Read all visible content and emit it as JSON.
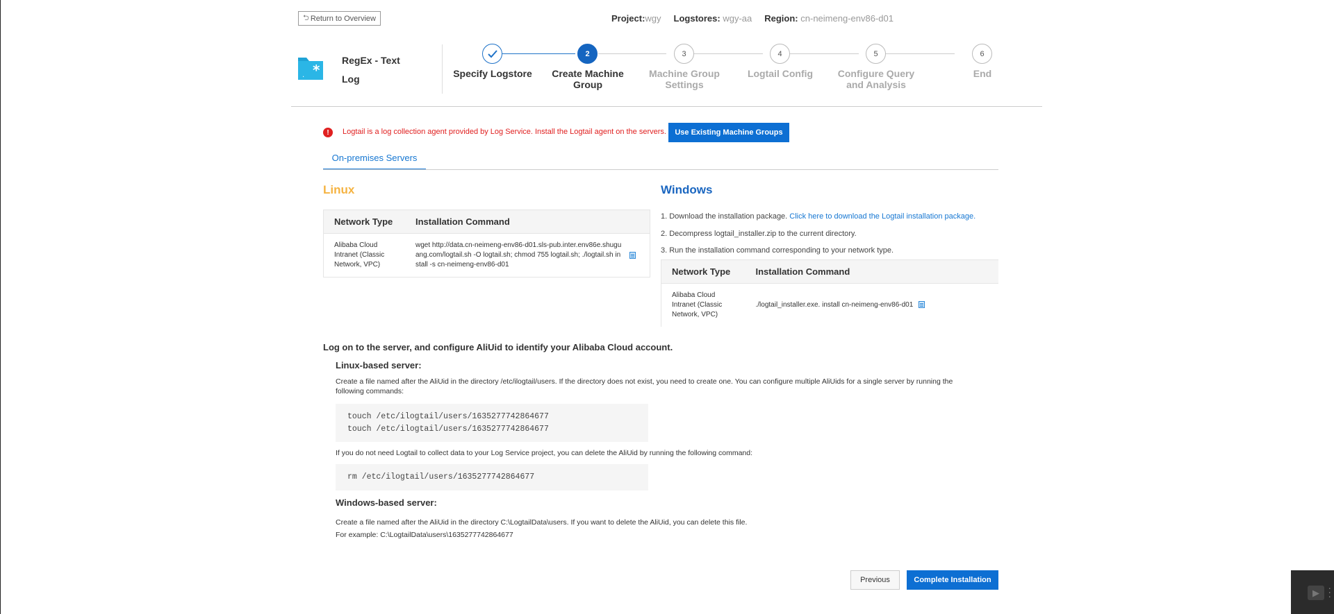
{
  "header": {
    "return_label": "Return to Overview",
    "project_label": "Project:",
    "project_value": "wgy",
    "logstores_label": "Logstores:",
    "logstores_value": "wgy-aa",
    "region_label": "Region:",
    "region_value": "cn-neimeng-env86-d01"
  },
  "log_type": {
    "title": "RegEx - Text Log",
    "icon": "folder-regex-icon"
  },
  "steps": [
    {
      "number": "✓",
      "label": "Specify Logstore",
      "state": "done"
    },
    {
      "number": "2",
      "label": "Create Machine Group",
      "state": "active"
    },
    {
      "number": "3",
      "label": "Machine Group Settings",
      "state": "pending"
    },
    {
      "number": "4",
      "label": "Logtail Config",
      "state": "pending"
    },
    {
      "number": "5",
      "label": "Configure Query and Analysis",
      "state": "pending"
    },
    {
      "number": "6",
      "label": "End",
      "state": "pending"
    }
  ],
  "alert": {
    "icon": "error-icon",
    "text": "Logtail is a log collection agent provided by Log Service. Install the Logtail agent on the servers.",
    "button_label": "Use Existing Machine Groups"
  },
  "tabs": [
    {
      "label": "On-premises Servers",
      "active": true
    }
  ],
  "linux": {
    "heading": "Linux",
    "table": {
      "headers": [
        "Network Type",
        "Installation Command"
      ],
      "rows": [
        {
          "network": "Alibaba Cloud Intranet (Classic Network, VPC)",
          "command": "wget http://data.cn-neimeng-env86-d01.sls-pub.inter.env86e.shuguang.com/logtail.sh -O logtail.sh; chmod 755 logtail.sh; ./logtail.sh install -s cn-neimeng-env86-d01"
        }
      ]
    }
  },
  "windows": {
    "heading": "Windows",
    "step1_text": "1. Download the installation package. ",
    "step1_link": "Click here to download the Logtail installation package.",
    "step2_text": "2. Decompress logtail_installer.zip to the current directory.",
    "step3_text": "3. Run the installation command corresponding to your network type.",
    "table": {
      "headers": [
        "Network Type",
        "Installation Command"
      ],
      "rows": [
        {
          "network": "Alibaba Cloud Intranet (Classic Network, VPC)",
          "command": "./logtail_installer.exe. install cn-neimeng-env86-d01"
        }
      ]
    }
  },
  "aliuid": {
    "heading": "Log on to the server, and configure AliUid to identify your Alibaba Cloud account.",
    "linux_heading": "Linux-based server:",
    "linux_desc": "Create a file named after the AliUid in the directory /etc/ilogtail/users. If the directory does not exist, you need to create one. You can configure multiple AliUids for a single server by running the following commands:",
    "touch_commands": [
      "touch /etc/ilogtail/users/1635277742864677",
      "touch /etc/ilogtail/users/1635277742864677"
    ],
    "delete_desc": "If you do not need Logtail to collect data to your Log Service project, you can delete the AliUid by running the following command:",
    "rm_command": "rm /etc/ilogtail/users/1635277742864677",
    "windows_heading": "Windows-based server:",
    "windows_desc": "Create a file named after the AliUid in the directory C:\\LogtailData\\users. If you want to delete the AliUid, you can delete this file.",
    "windows_example": "For example: C:\\LogtailData\\users\\1635277742864677"
  },
  "footer": {
    "previous_label": "Previous",
    "complete_label": "Complete Installation"
  },
  "colors": {
    "primary": "#0d6fd3",
    "alert": "#e02020",
    "linux_heading": "#f5b342",
    "windows_heading": "#1a66c0",
    "link": "#1677d2"
  }
}
